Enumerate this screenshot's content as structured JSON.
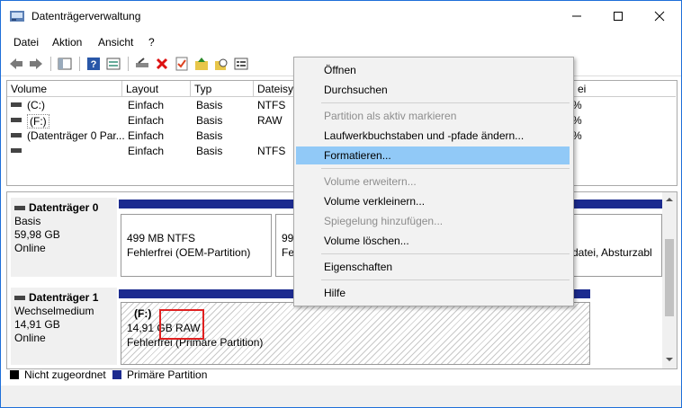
{
  "window": {
    "title": "Datenträgerverwaltung",
    "minimize": "—",
    "maximize": "☐",
    "close": "✕"
  },
  "menu": [
    "Datei",
    "Aktion",
    "Ansicht",
    "?"
  ],
  "table": {
    "headers": [
      "Volume",
      "Layout",
      "Typ",
      "Dateisy",
      "ei"
    ],
    "rows": [
      {
        "volume": "(C:)",
        "layout": "Einfach",
        "typ": "Basis",
        "fs": "NTFS",
        "right": "%"
      },
      {
        "volume": "(F:)",
        "layout": "Einfach",
        "typ": "Basis",
        "fs": "RAW",
        "right": "%"
      },
      {
        "volume": "(Datenträger 0 Par...",
        "layout": "Einfach",
        "typ": "Basis",
        "fs": "",
        "right": "%"
      },
      {
        "volume": "",
        "layout": "Einfach",
        "typ": "Basis",
        "fs": "NTFS",
        "right": ""
      }
    ]
  },
  "disks": [
    {
      "name": "Datenträger 0",
      "type": "Basis",
      "size": "59,98 GB",
      "status": "Online",
      "p1_line1": "499 MB NTFS",
      "p1_line2": "Fehlerfrei (OEM-Partition)",
      "p2_line1": "99",
      "p2_line2": "Fe",
      "p3_line2": "sdatei, Absturzabl"
    },
    {
      "name": "Datenträger 1",
      "type": "Wechselmedium",
      "size": "14,91 GB",
      "status": "Online",
      "p1_label": "(F:)",
      "p1_line1": "14,91 GB RAW",
      "p1_line2": "Fehlerfrei (Primäre Partition)"
    }
  ],
  "legend": {
    "unallocated": "Nicht zugeordnet",
    "primary": "Primäre Partition",
    "unallocated_color": "#000000",
    "primary_color": "#1c2b8f"
  },
  "context_menu": {
    "open": "Öffnen",
    "explore": "Durchsuchen",
    "mark_active": "Partition als aktiv markieren",
    "change_letter": "Laufwerkbuchstaben und -pfade ändern...",
    "format": "Formatieren...",
    "extend": "Volume erweitern...",
    "shrink": "Volume verkleinern...",
    "mirror": "Spiegelung hinzufügen...",
    "delete": "Volume löschen...",
    "properties": "Eigenschaften",
    "help": "Hilfe"
  },
  "colors": {
    "highlight": "#91c9f7",
    "disk_bar": "#1c2b8f",
    "annotation": "#e02020"
  }
}
